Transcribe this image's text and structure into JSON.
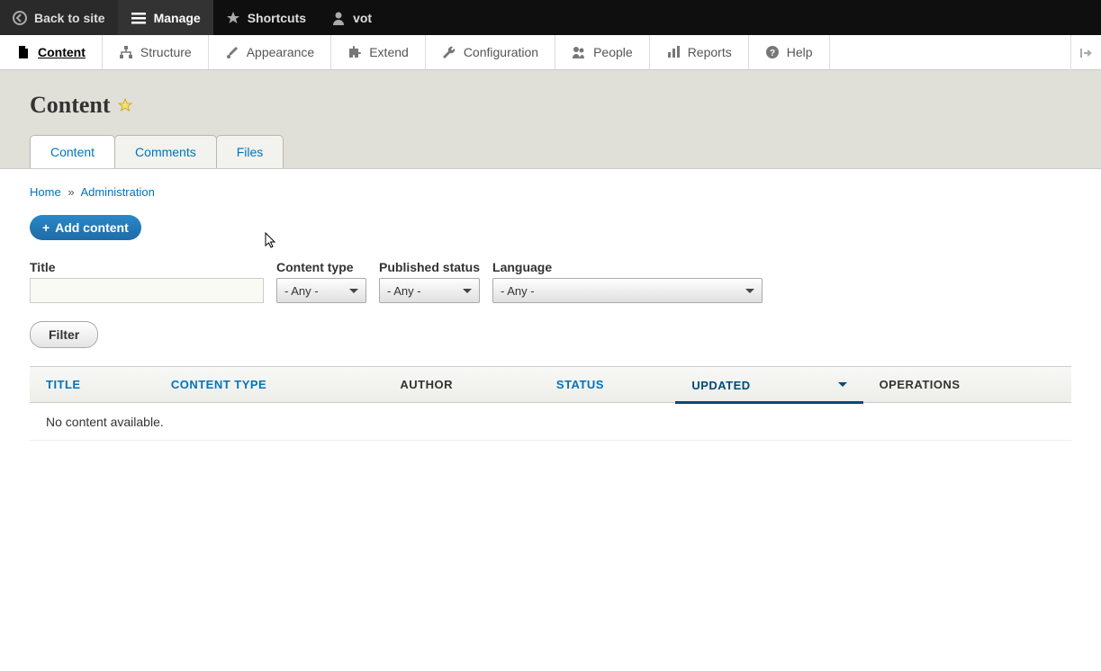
{
  "toolbar": {
    "back": "Back to site",
    "manage": "Manage",
    "shortcuts": "Shortcuts",
    "user": "vot"
  },
  "admin_menu": {
    "content": "Content",
    "structure": "Structure",
    "appearance": "Appearance",
    "extend": "Extend",
    "configuration": "Configuration",
    "people": "People",
    "reports": "Reports",
    "help": "Help"
  },
  "page": {
    "title": "Content"
  },
  "tabs": {
    "content": "Content",
    "comments": "Comments",
    "files": "Files"
  },
  "breadcrumb": {
    "home": "Home",
    "administration": "Administration"
  },
  "actions": {
    "add_content": "Add content"
  },
  "filters": {
    "title_label": "Title",
    "title_value": "",
    "type_label": "Content type",
    "type_value": "- Any -",
    "status_label": "Published status",
    "status_value": "- Any -",
    "language_label": "Language",
    "language_value": "- Any -",
    "button": "Filter"
  },
  "table": {
    "headers": {
      "title": "TITLE",
      "content_type": "CONTENT TYPE",
      "author": "AUTHOR",
      "status": "STATUS",
      "updated": "UPDATED",
      "operations": "OPERATIONS"
    },
    "empty": "No content available."
  }
}
